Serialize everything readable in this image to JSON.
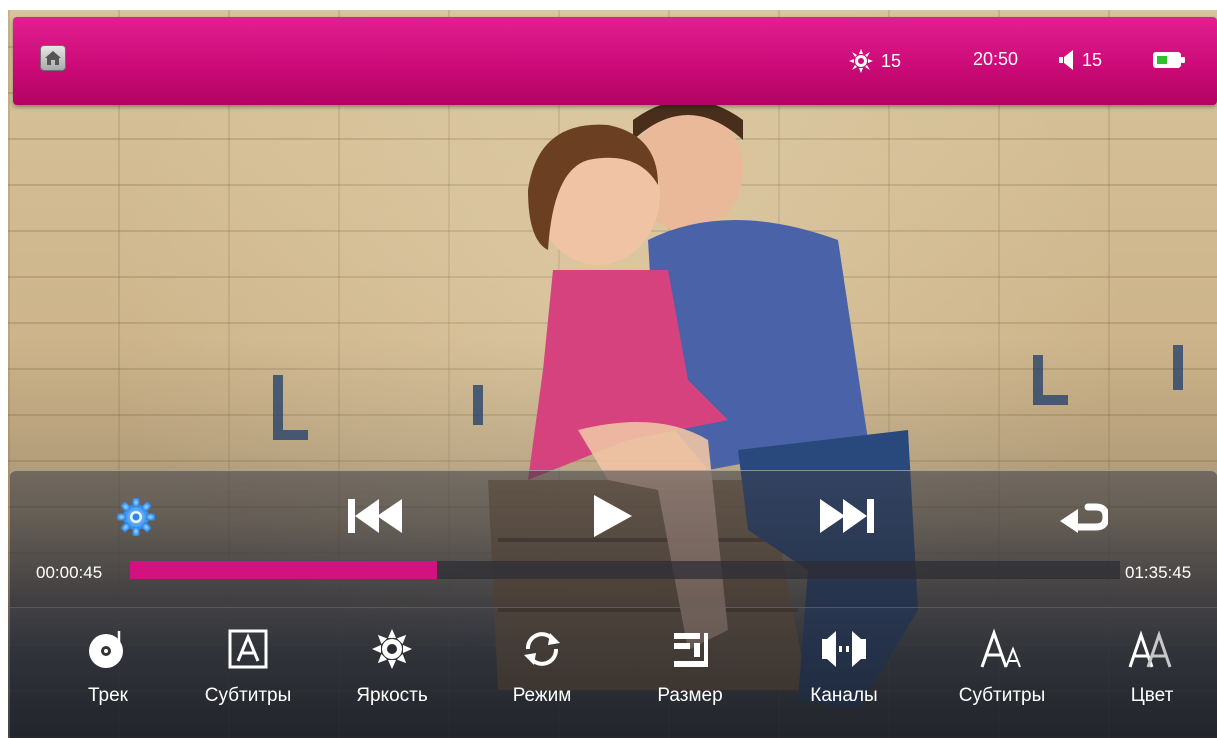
{
  "status_bar": {
    "brightness_value": "15",
    "clock": "20:50",
    "volume_value": "15",
    "battery_level": 0.5
  },
  "player": {
    "current_time": "00:00:45",
    "total_time": "01:35:45",
    "progress": 0.31
  },
  "menu": {
    "items": [
      {
        "label": "Трек",
        "icon": "track-disc-icon"
      },
      {
        "label": "Субтитры",
        "icon": "subtitles-icon"
      },
      {
        "label": "Яркость",
        "icon": "brightness-icon"
      },
      {
        "label": "Режим",
        "icon": "mode-cycle-icon"
      },
      {
        "label": "Размер",
        "icon": "size-icon"
      },
      {
        "label": "Каналы",
        "icon": "channels-icon"
      },
      {
        "label": "Субтитры",
        "icon": "subtitle-font-size-icon"
      },
      {
        "label": "Цвет",
        "icon": "subtitle-color-icon"
      }
    ]
  },
  "colors": {
    "accent": "#d4127f",
    "statusbar": "#cc0a78",
    "settings_icon": "#3aa0ff"
  }
}
